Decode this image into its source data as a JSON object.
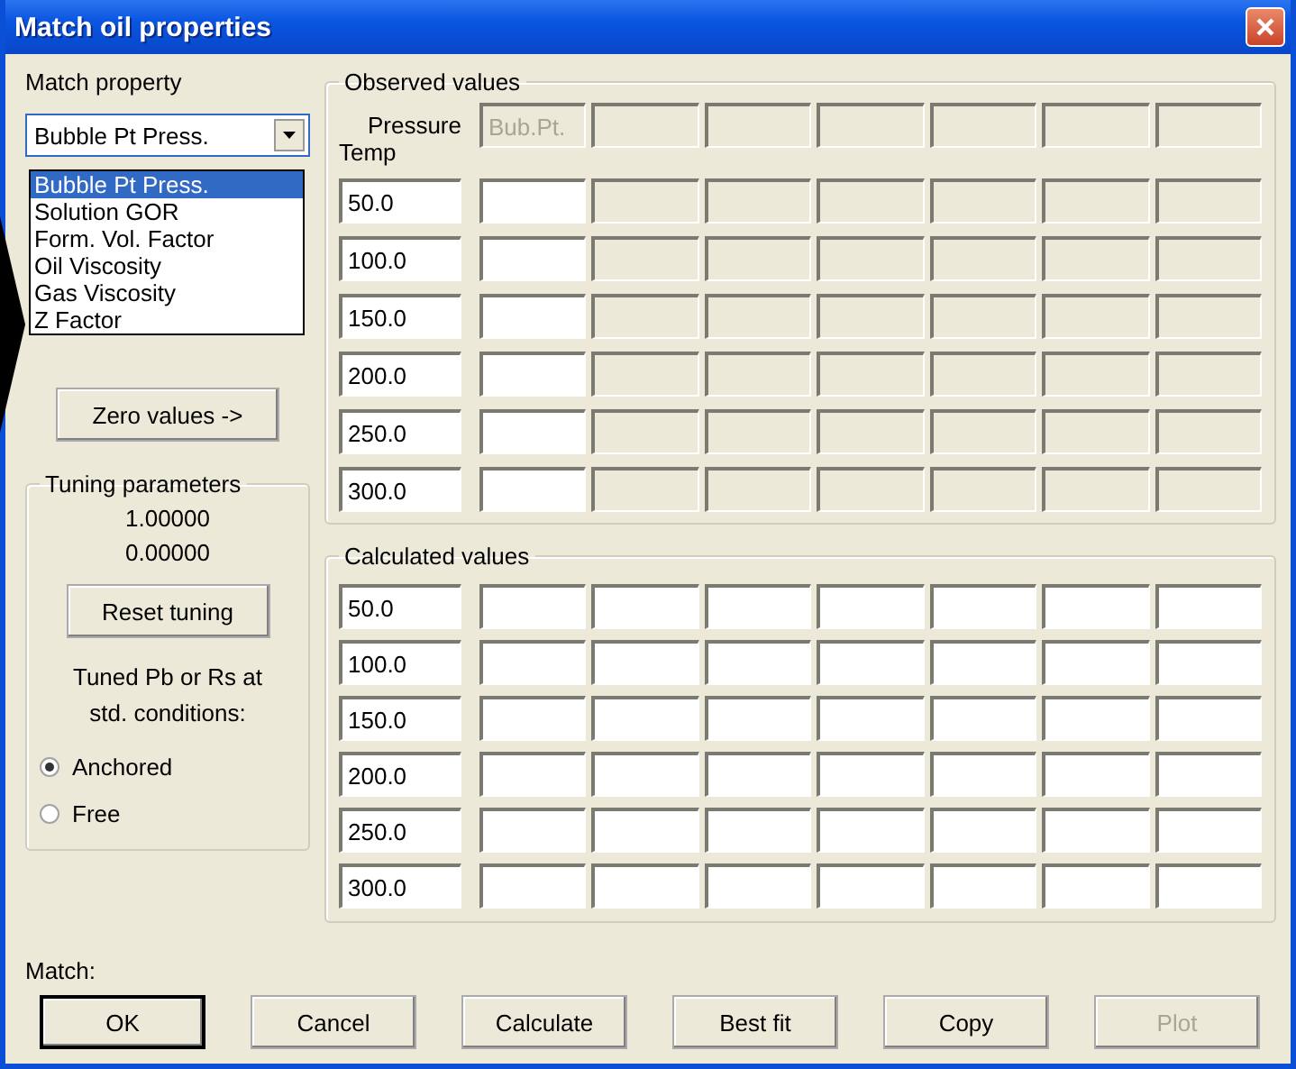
{
  "window": {
    "title": "Match oil properties"
  },
  "match_property": {
    "label": "Match property",
    "value": "Bubble Pt Press.",
    "expanded": true,
    "options": [
      {
        "label": "Bubble Pt Press.",
        "selected": true
      },
      {
        "label": "Solution GOR",
        "selected": false
      },
      {
        "label": "Form. Vol. Factor",
        "selected": false
      },
      {
        "label": "Oil Viscosity",
        "selected": false
      },
      {
        "label": "Gas Viscosity",
        "selected": false
      },
      {
        "label": "Z Factor",
        "selected": false
      }
    ]
  },
  "zero_button": {
    "label": "Zero values ->"
  },
  "tuning": {
    "title": "Tuning parameters",
    "values": [
      "1.00000",
      "0.00000"
    ],
    "reset_button": "Reset tuning",
    "note": "Tuned Pb or Rs at std. conditions:",
    "radios": [
      {
        "label": "Anchored",
        "selected": true
      },
      {
        "label": "Free",
        "selected": false
      }
    ]
  },
  "match_label": "Match:",
  "observed": {
    "title": "Observed values",
    "pressure_label": "Pressure",
    "temp_label": "Temp",
    "header_cells": [
      {
        "value": "Bub.Pt.",
        "disabled": true
      },
      {
        "disabled": true
      },
      {
        "disabled": true
      },
      {
        "disabled": true
      },
      {
        "disabled": true
      },
      {
        "disabled": true
      },
      {
        "disabled": true
      }
    ],
    "rows": [
      {
        "temp": "50.0",
        "cells": [
          {
            "disabled": false
          },
          {
            "disabled": true
          },
          {
            "disabled": true
          },
          {
            "disabled": true
          },
          {
            "disabled": true
          },
          {
            "disabled": true
          },
          {
            "disabled": true
          }
        ]
      },
      {
        "temp": "100.0",
        "cells": [
          {
            "disabled": false
          },
          {
            "disabled": true
          },
          {
            "disabled": true
          },
          {
            "disabled": true
          },
          {
            "disabled": true
          },
          {
            "disabled": true
          },
          {
            "disabled": true
          }
        ]
      },
      {
        "temp": "150.0",
        "cells": [
          {
            "disabled": false
          },
          {
            "disabled": true
          },
          {
            "disabled": true
          },
          {
            "disabled": true
          },
          {
            "disabled": true
          },
          {
            "disabled": true
          },
          {
            "disabled": true
          }
        ]
      },
      {
        "temp": "200.0",
        "cells": [
          {
            "disabled": false
          },
          {
            "disabled": true
          },
          {
            "disabled": true
          },
          {
            "disabled": true
          },
          {
            "disabled": true
          },
          {
            "disabled": true
          },
          {
            "disabled": true
          }
        ]
      },
      {
        "temp": "250.0",
        "cells": [
          {
            "disabled": false
          },
          {
            "disabled": true
          },
          {
            "disabled": true
          },
          {
            "disabled": true
          },
          {
            "disabled": true
          },
          {
            "disabled": true
          },
          {
            "disabled": true
          }
        ]
      },
      {
        "temp": "300.0",
        "cells": [
          {
            "disabled": false
          },
          {
            "disabled": true
          },
          {
            "disabled": true
          },
          {
            "disabled": true
          },
          {
            "disabled": true
          },
          {
            "disabled": true
          },
          {
            "disabled": true
          }
        ]
      }
    ]
  },
  "calculated": {
    "title": "Calculated values",
    "rows": [
      {
        "temp": "50.0",
        "cells": [
          {
            "disabled": false
          },
          {
            "disabled": false
          },
          {
            "disabled": false
          },
          {
            "disabled": false
          },
          {
            "disabled": false
          },
          {
            "disabled": false
          },
          {
            "disabled": false
          }
        ]
      },
      {
        "temp": "100.0",
        "cells": [
          {
            "disabled": false
          },
          {
            "disabled": false
          },
          {
            "disabled": false
          },
          {
            "disabled": false
          },
          {
            "disabled": false
          },
          {
            "disabled": false
          },
          {
            "disabled": false
          }
        ]
      },
      {
        "temp": "150.0",
        "cells": [
          {
            "disabled": false
          },
          {
            "disabled": false
          },
          {
            "disabled": false
          },
          {
            "disabled": false
          },
          {
            "disabled": false
          },
          {
            "disabled": false
          },
          {
            "disabled": false
          }
        ]
      },
      {
        "temp": "200.0",
        "cells": [
          {
            "disabled": false
          },
          {
            "disabled": false
          },
          {
            "disabled": false
          },
          {
            "disabled": false
          },
          {
            "disabled": false
          },
          {
            "disabled": false
          },
          {
            "disabled": false
          }
        ]
      },
      {
        "temp": "250.0",
        "cells": [
          {
            "disabled": false
          },
          {
            "disabled": false
          },
          {
            "disabled": false
          },
          {
            "disabled": false
          },
          {
            "disabled": false
          },
          {
            "disabled": false
          },
          {
            "disabled": false
          }
        ]
      },
      {
        "temp": "300.0",
        "cells": [
          {
            "disabled": false
          },
          {
            "disabled": false
          },
          {
            "disabled": false
          },
          {
            "disabled": false
          },
          {
            "disabled": false
          },
          {
            "disabled": false
          },
          {
            "disabled": false
          }
        ]
      }
    ]
  },
  "buttons": [
    {
      "label": "OK",
      "default": true,
      "disabled": false
    },
    {
      "label": "Cancel",
      "default": false,
      "disabled": false
    },
    {
      "label": "Calculate",
      "default": false,
      "disabled": false
    },
    {
      "label": "Best fit",
      "default": false,
      "disabled": false
    },
    {
      "label": "Copy",
      "default": false,
      "disabled": false
    },
    {
      "label": "Plot",
      "default": false,
      "disabled": true
    }
  ]
}
